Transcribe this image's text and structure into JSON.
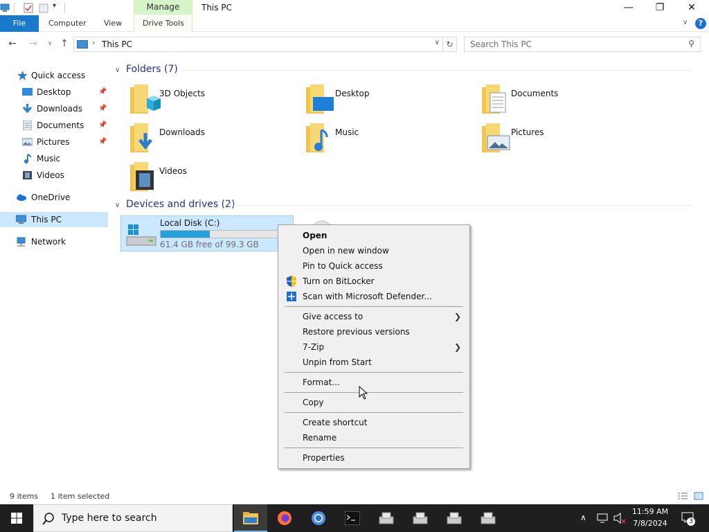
{
  "window": {
    "title": "This PC",
    "context_tab": "Manage",
    "controls": {
      "minimize": "—",
      "maximize": "❐",
      "close": "✕"
    }
  },
  "ribbon": {
    "tabs": [
      "File",
      "Computer",
      "View",
      "Drive Tools"
    ],
    "help": "?"
  },
  "address": {
    "path": "This PC",
    "search_placeholder": "Search This PC"
  },
  "sidebar": {
    "quick_access": "Quick access",
    "items": [
      {
        "label": "Desktop",
        "pinned": true
      },
      {
        "label": "Downloads",
        "pinned": true
      },
      {
        "label": "Documents",
        "pinned": true
      },
      {
        "label": "Pictures",
        "pinned": true
      },
      {
        "label": "Music",
        "pinned": false
      },
      {
        "label": "Videos",
        "pinned": false
      }
    ],
    "onedrive": "OneDrive",
    "this_pc": "This PC",
    "network": "Network"
  },
  "content": {
    "folders_header": "Folders (7)",
    "folders": [
      "3D Objects",
      "Desktop",
      "Documents",
      "Downloads",
      "Music",
      "Pictures",
      "Videos"
    ],
    "devices_header": "Devices and drives (2)",
    "drives": [
      {
        "label": "Local Disk (C:)",
        "free_text": "61.4 GB free of 99.3 GB",
        "used_fraction": 0.38
      }
    ]
  },
  "context_menu": {
    "items": [
      "Open",
      "Open in new window",
      "Pin to Quick access",
      "Turn on BitLocker",
      "Scan with Microsoft Defender...",
      "Give access to",
      "Restore previous versions",
      "7-Zip",
      "Unpin from Start",
      "Format...",
      "Copy",
      "Create shortcut",
      "Rename",
      "Properties"
    ]
  },
  "status": {
    "items_count": "9 items",
    "selected": "1 item selected"
  },
  "taskbar": {
    "search_placeholder": "Type here to search",
    "time": "11:59 AM",
    "date": "7/8/2024",
    "notification_count": "3"
  },
  "colors": {
    "accent": "#1979ca",
    "selection": "#cce8ff",
    "drive_bar": "#26a0da",
    "manage_tab": "#d7f3c8",
    "header_text": "#1e3287"
  }
}
